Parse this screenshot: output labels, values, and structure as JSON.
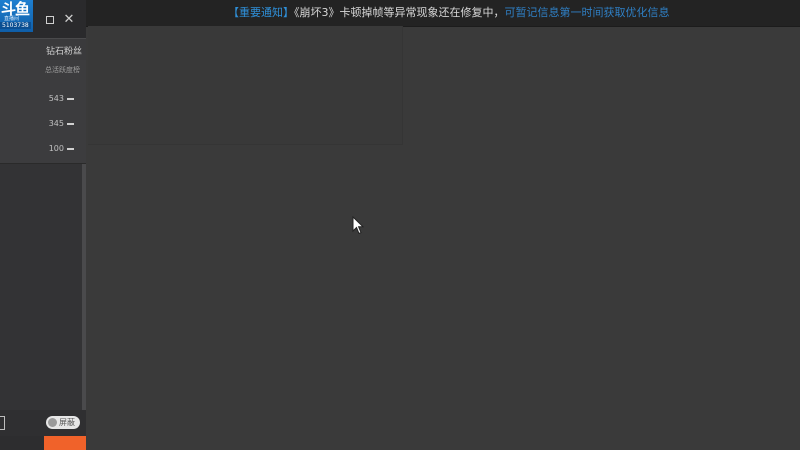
{
  "notice": {
    "tag": "【重要通知】",
    "main": "《崩坏3》卡顿掉帧等异常现象还在修复中，",
    "tail": "可暂记信息第一时间获取优化信息"
  },
  "logo": {
    "mark": "斗鱼",
    "sub": "直播间",
    "id": "5103738"
  },
  "sidebar": {
    "fans_title": "钻石粉丝",
    "rank_sub": "总活跃度榜",
    "rank_values": [
      "543",
      "345",
      "100"
    ],
    "toggle_label": "屏蔽"
  },
  "colors": {
    "accent": "#2f8fd8",
    "orange": "#f0622a",
    "background": "#3a3a3a"
  },
  "icons": {
    "restore": "restore-window-icon",
    "close": "close-icon",
    "cursor": "mouse-pointer-icon"
  }
}
